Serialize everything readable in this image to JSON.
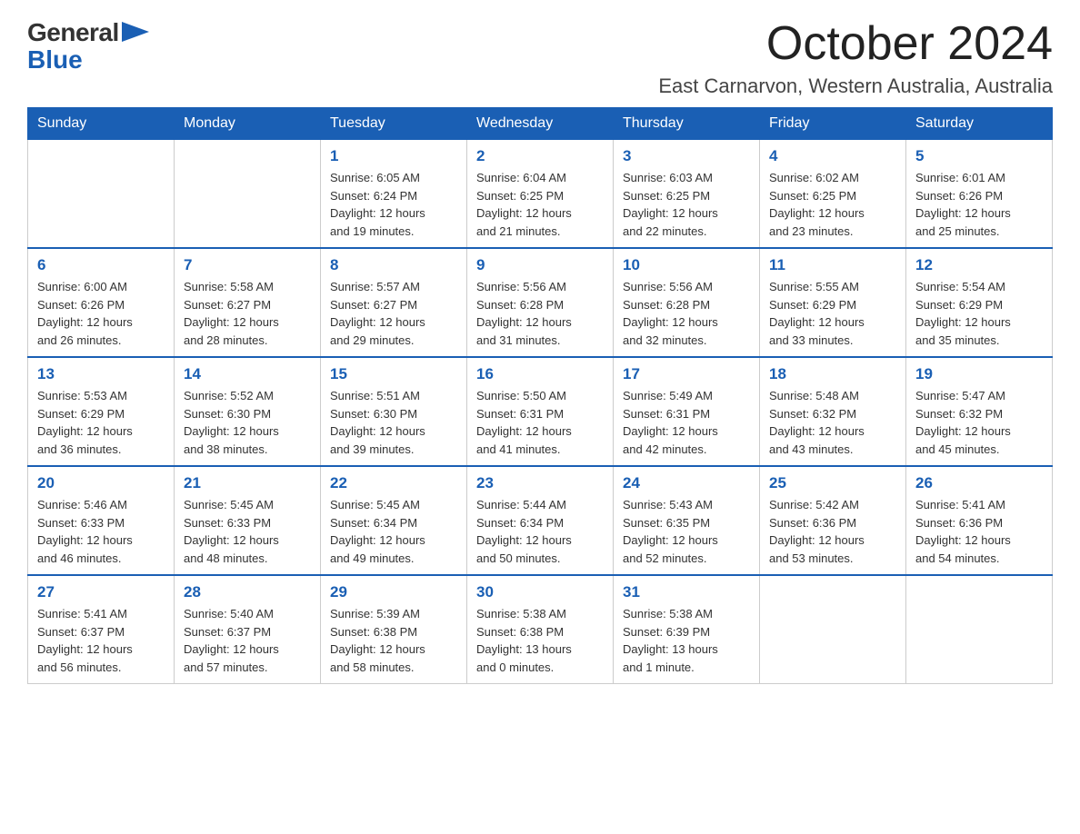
{
  "logo": {
    "general": "General",
    "blue": "Blue"
  },
  "header": {
    "month_year": "October 2024",
    "location": "East Carnarvon, Western Australia, Australia"
  },
  "days_of_week": [
    "Sunday",
    "Monday",
    "Tuesday",
    "Wednesday",
    "Thursday",
    "Friday",
    "Saturday"
  ],
  "weeks": [
    [
      {
        "day": "",
        "info": ""
      },
      {
        "day": "",
        "info": ""
      },
      {
        "day": "1",
        "info": "Sunrise: 6:05 AM\nSunset: 6:24 PM\nDaylight: 12 hours\nand 19 minutes."
      },
      {
        "day": "2",
        "info": "Sunrise: 6:04 AM\nSunset: 6:25 PM\nDaylight: 12 hours\nand 21 minutes."
      },
      {
        "day": "3",
        "info": "Sunrise: 6:03 AM\nSunset: 6:25 PM\nDaylight: 12 hours\nand 22 minutes."
      },
      {
        "day": "4",
        "info": "Sunrise: 6:02 AM\nSunset: 6:25 PM\nDaylight: 12 hours\nand 23 minutes."
      },
      {
        "day": "5",
        "info": "Sunrise: 6:01 AM\nSunset: 6:26 PM\nDaylight: 12 hours\nand 25 minutes."
      }
    ],
    [
      {
        "day": "6",
        "info": "Sunrise: 6:00 AM\nSunset: 6:26 PM\nDaylight: 12 hours\nand 26 minutes."
      },
      {
        "day": "7",
        "info": "Sunrise: 5:58 AM\nSunset: 6:27 PM\nDaylight: 12 hours\nand 28 minutes."
      },
      {
        "day": "8",
        "info": "Sunrise: 5:57 AM\nSunset: 6:27 PM\nDaylight: 12 hours\nand 29 minutes."
      },
      {
        "day": "9",
        "info": "Sunrise: 5:56 AM\nSunset: 6:28 PM\nDaylight: 12 hours\nand 31 minutes."
      },
      {
        "day": "10",
        "info": "Sunrise: 5:56 AM\nSunset: 6:28 PM\nDaylight: 12 hours\nand 32 minutes."
      },
      {
        "day": "11",
        "info": "Sunrise: 5:55 AM\nSunset: 6:29 PM\nDaylight: 12 hours\nand 33 minutes."
      },
      {
        "day": "12",
        "info": "Sunrise: 5:54 AM\nSunset: 6:29 PM\nDaylight: 12 hours\nand 35 minutes."
      }
    ],
    [
      {
        "day": "13",
        "info": "Sunrise: 5:53 AM\nSunset: 6:29 PM\nDaylight: 12 hours\nand 36 minutes."
      },
      {
        "day": "14",
        "info": "Sunrise: 5:52 AM\nSunset: 6:30 PM\nDaylight: 12 hours\nand 38 minutes."
      },
      {
        "day": "15",
        "info": "Sunrise: 5:51 AM\nSunset: 6:30 PM\nDaylight: 12 hours\nand 39 minutes."
      },
      {
        "day": "16",
        "info": "Sunrise: 5:50 AM\nSunset: 6:31 PM\nDaylight: 12 hours\nand 41 minutes."
      },
      {
        "day": "17",
        "info": "Sunrise: 5:49 AM\nSunset: 6:31 PM\nDaylight: 12 hours\nand 42 minutes."
      },
      {
        "day": "18",
        "info": "Sunrise: 5:48 AM\nSunset: 6:32 PM\nDaylight: 12 hours\nand 43 minutes."
      },
      {
        "day": "19",
        "info": "Sunrise: 5:47 AM\nSunset: 6:32 PM\nDaylight: 12 hours\nand 45 minutes."
      }
    ],
    [
      {
        "day": "20",
        "info": "Sunrise: 5:46 AM\nSunset: 6:33 PM\nDaylight: 12 hours\nand 46 minutes."
      },
      {
        "day": "21",
        "info": "Sunrise: 5:45 AM\nSunset: 6:33 PM\nDaylight: 12 hours\nand 48 minutes."
      },
      {
        "day": "22",
        "info": "Sunrise: 5:45 AM\nSunset: 6:34 PM\nDaylight: 12 hours\nand 49 minutes."
      },
      {
        "day": "23",
        "info": "Sunrise: 5:44 AM\nSunset: 6:34 PM\nDaylight: 12 hours\nand 50 minutes."
      },
      {
        "day": "24",
        "info": "Sunrise: 5:43 AM\nSunset: 6:35 PM\nDaylight: 12 hours\nand 52 minutes."
      },
      {
        "day": "25",
        "info": "Sunrise: 5:42 AM\nSunset: 6:36 PM\nDaylight: 12 hours\nand 53 minutes."
      },
      {
        "day": "26",
        "info": "Sunrise: 5:41 AM\nSunset: 6:36 PM\nDaylight: 12 hours\nand 54 minutes."
      }
    ],
    [
      {
        "day": "27",
        "info": "Sunrise: 5:41 AM\nSunset: 6:37 PM\nDaylight: 12 hours\nand 56 minutes."
      },
      {
        "day": "28",
        "info": "Sunrise: 5:40 AM\nSunset: 6:37 PM\nDaylight: 12 hours\nand 57 minutes."
      },
      {
        "day": "29",
        "info": "Sunrise: 5:39 AM\nSunset: 6:38 PM\nDaylight: 12 hours\nand 58 minutes."
      },
      {
        "day": "30",
        "info": "Sunrise: 5:38 AM\nSunset: 6:38 PM\nDaylight: 13 hours\nand 0 minutes."
      },
      {
        "day": "31",
        "info": "Sunrise: 5:38 AM\nSunset: 6:39 PM\nDaylight: 13 hours\nand 1 minute."
      },
      {
        "day": "",
        "info": ""
      },
      {
        "day": "",
        "info": ""
      }
    ]
  ]
}
